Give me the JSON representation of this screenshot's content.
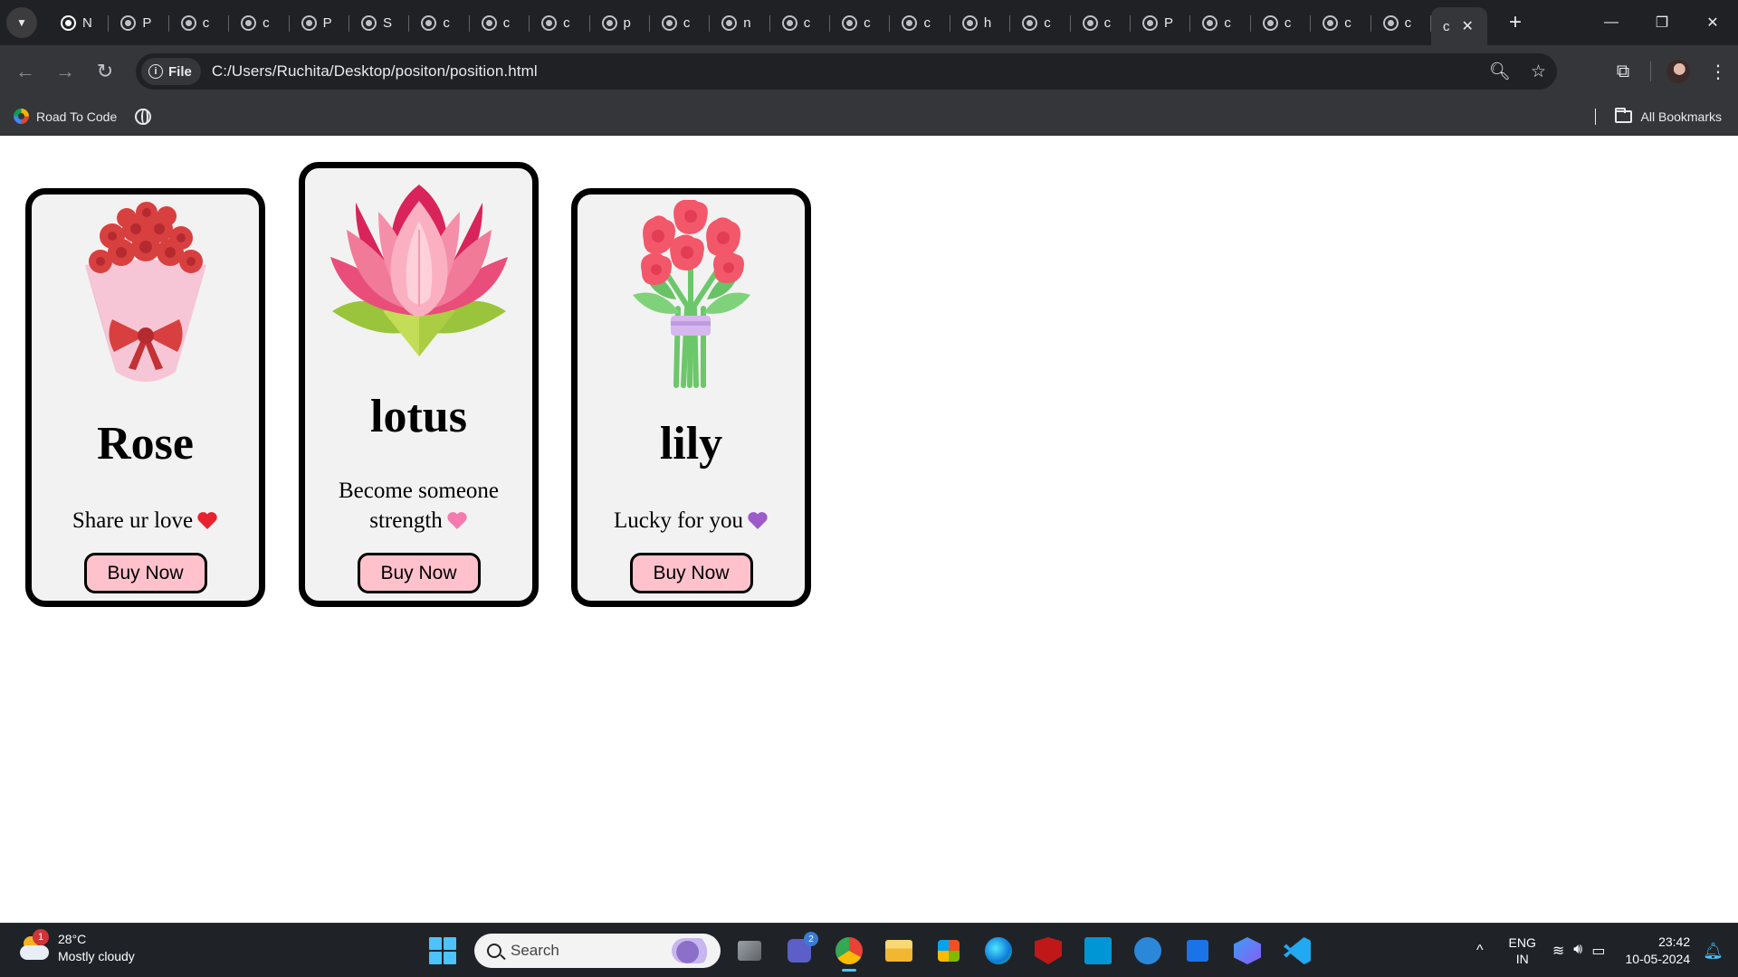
{
  "browser": {
    "tabs": [
      {
        "letter": "N",
        "kind": "chrome"
      },
      {
        "letter": "P",
        "kind": "globe"
      },
      {
        "letter": "c",
        "kind": "globe"
      },
      {
        "letter": "c",
        "kind": "globe"
      },
      {
        "letter": "P",
        "kind": "globe"
      },
      {
        "letter": "S",
        "kind": "globe"
      },
      {
        "letter": "c",
        "kind": "globe"
      },
      {
        "letter": "c",
        "kind": "globe"
      },
      {
        "letter": "c",
        "kind": "globe"
      },
      {
        "letter": "p",
        "kind": "globe"
      },
      {
        "letter": "c",
        "kind": "globe"
      },
      {
        "letter": "n",
        "kind": "globe"
      },
      {
        "letter": "c",
        "kind": "globe"
      },
      {
        "letter": "c",
        "kind": "globe"
      },
      {
        "letter": "c",
        "kind": "globe"
      },
      {
        "letter": "h",
        "kind": "globe"
      },
      {
        "letter": "c",
        "kind": "globe"
      },
      {
        "letter": "c",
        "kind": "globe"
      },
      {
        "letter": "P",
        "kind": "globe"
      },
      {
        "letter": "c",
        "kind": "globe"
      },
      {
        "letter": "c",
        "kind": "globe"
      },
      {
        "letter": "c",
        "kind": "globe"
      },
      {
        "letter": "c",
        "kind": "globe"
      }
    ],
    "active_tab": {
      "letter": "c",
      "close": "✕"
    },
    "new_tab": "+",
    "chip_label": "File",
    "url": "C:/Users/Ruchita/Desktop/positon/position.html",
    "bookmarks": [
      {
        "label": "Road To Code"
      }
    ],
    "all_bookmarks": "All Bookmarks"
  },
  "cards": {
    "rose": {
      "title": "Rose",
      "description": "Share ur love",
      "heart_color": "#e8232f",
      "button": "Buy Now"
    },
    "lotus": {
      "title": "lotus",
      "description": "Become someone strength",
      "heart_color": "#f47ab0",
      "button": "Buy Now"
    },
    "lily": {
      "title": "lily",
      "description": "Lucky for you",
      "heart_color": "#9d5ac9",
      "button": "Buy Now"
    }
  },
  "theme": {
    "card_bg": "#f2f2f2",
    "button_bg": "#ffc2cc",
    "chrome_dark": "#202124",
    "chrome_toolbar": "#35363a"
  },
  "taskbar": {
    "weather_badge": "1",
    "temperature": "28°C",
    "condition": "Mostly cloudy",
    "search_placeholder": "Search",
    "teams_badge": "2",
    "language_line1": "ENG",
    "language_line2": "IN",
    "time": "23:42",
    "date": "10-05-2024"
  }
}
